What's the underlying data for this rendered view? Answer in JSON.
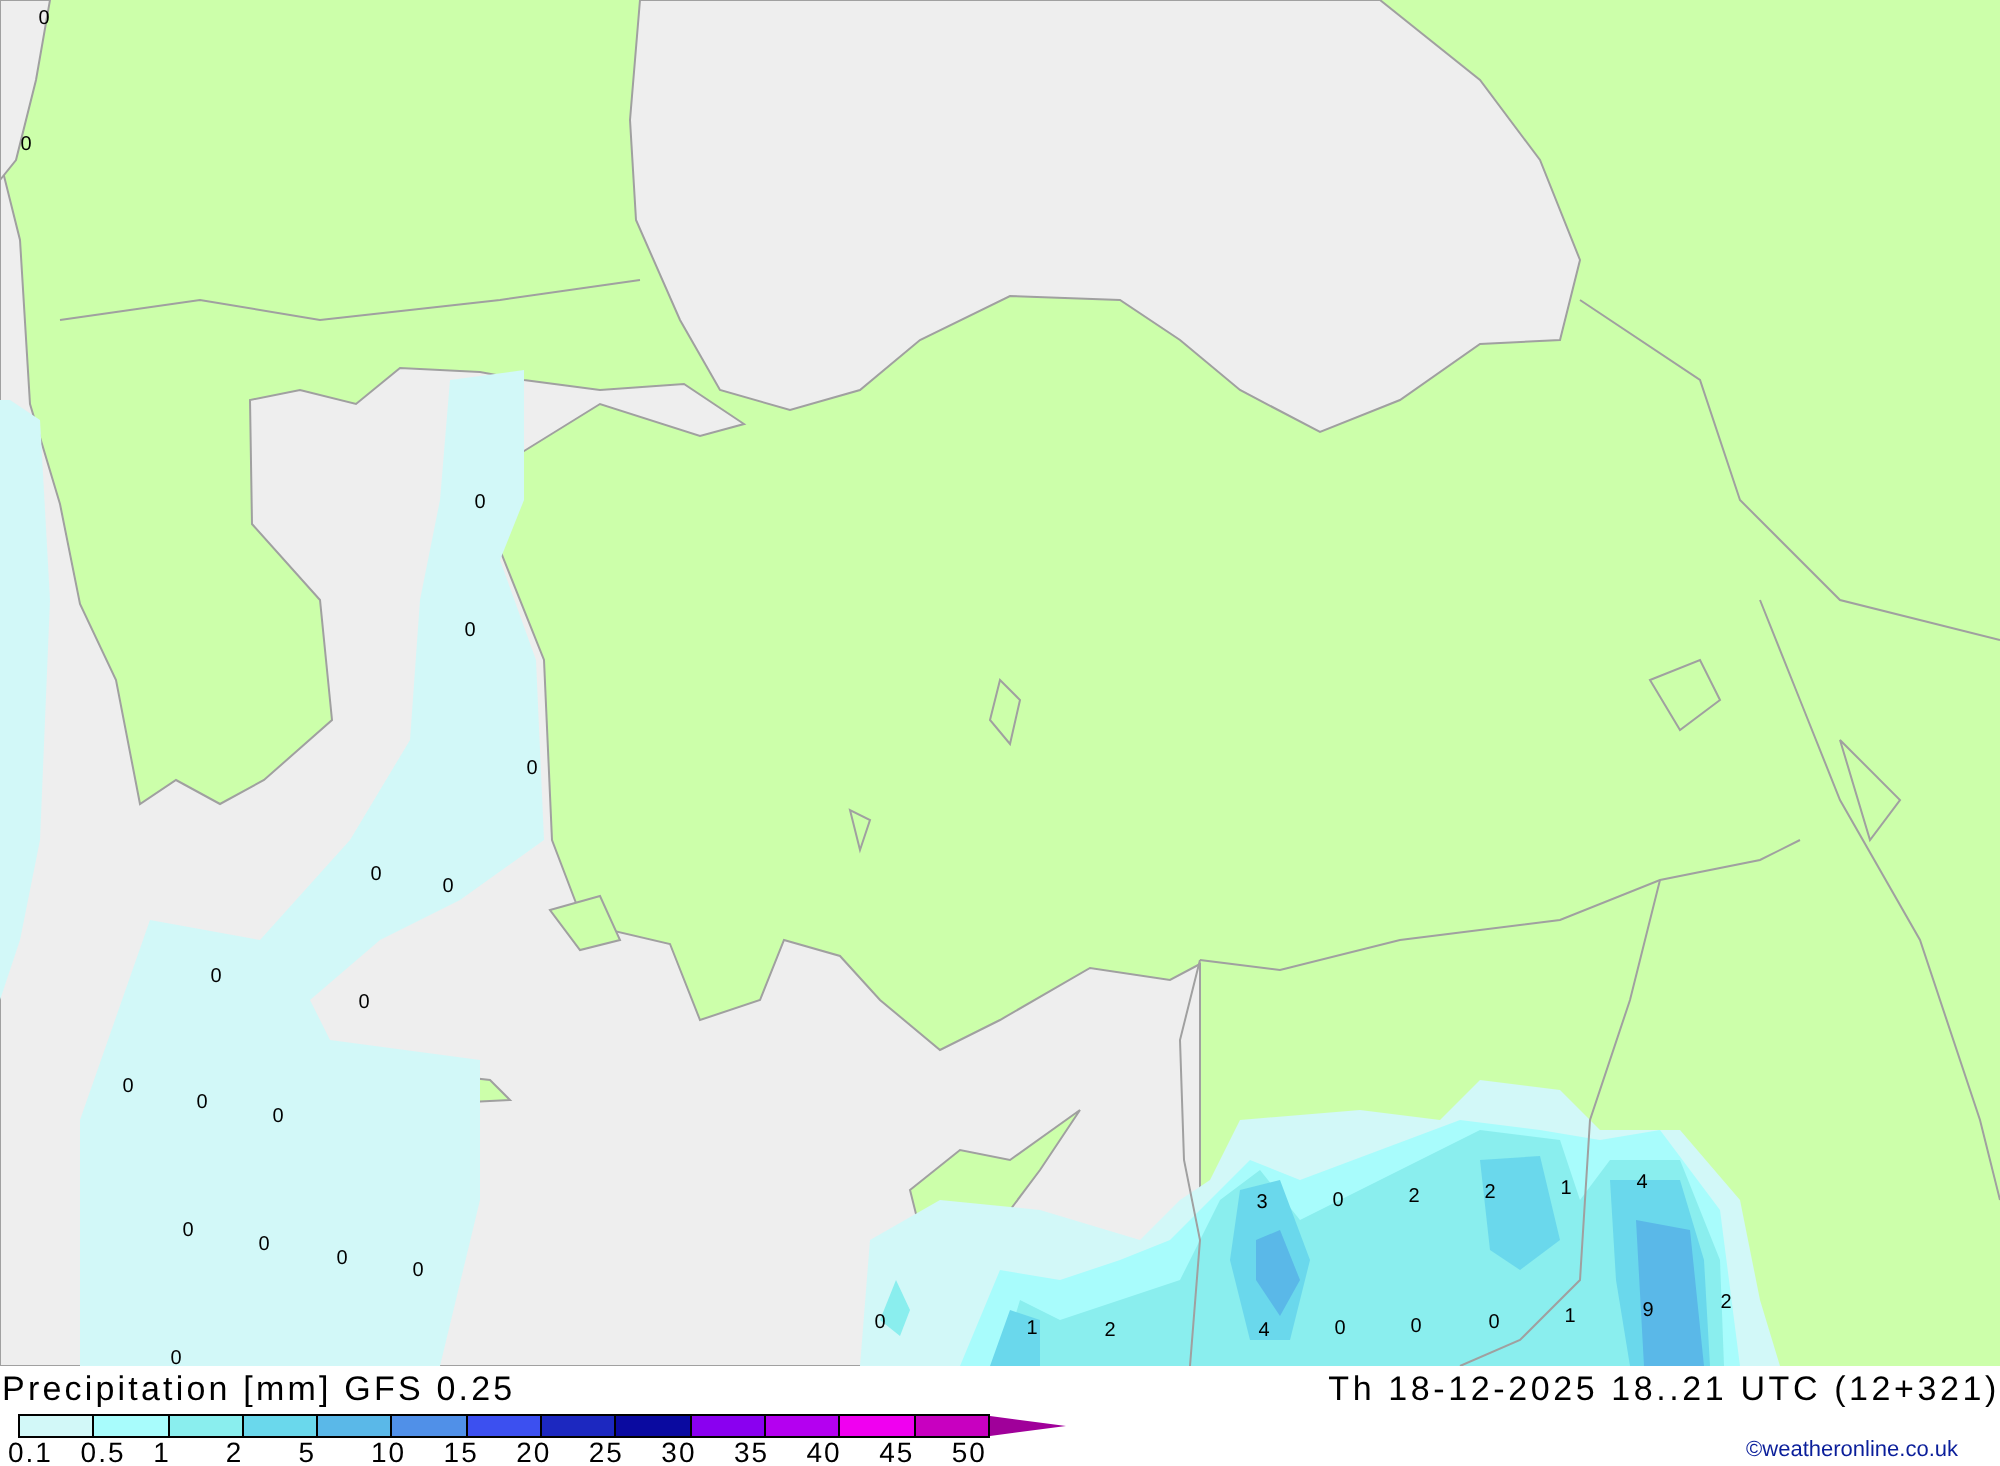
{
  "map_values": [
    "0",
    "0",
    "0",
    "0",
    "0",
    "0",
    "0",
    "0",
    "0",
    "0",
    "0",
    "0",
    "3",
    "0",
    "2",
    "2",
    "1",
    "4",
    "0",
    "0",
    "0",
    "0",
    "0",
    "1",
    "2",
    "4",
    "0",
    "0",
    "0",
    "1",
    "9",
    "2",
    "0"
  ],
  "title": "Precipitation [mm] GFS 0.25",
  "valid_time": "Th 18-12-2025 18..21 UTC (12+321)",
  "legend": {
    "items": [
      {
        "kind": "box",
        "color": "#d2f8f8"
      },
      {
        "kind": "box",
        "color": "#a8fcfc"
      },
      {
        "kind": "box",
        "color": "#8aeeee"
      },
      {
        "kind": "box",
        "color": "#6ad8ec"
      },
      {
        "kind": "box",
        "color": "#5ab8e8"
      },
      {
        "kind": "box",
        "color": "#5090e8"
      },
      {
        "kind": "box",
        "color": "#3c50f0"
      },
      {
        "kind": "box",
        "color": "#1c28c0"
      },
      {
        "kind": "box",
        "color": "#0a0aa0"
      },
      {
        "kind": "box",
        "color": "#8a00f0"
      },
      {
        "kind": "box",
        "color": "#b400f0"
      },
      {
        "kind": "box",
        "color": "#f000f0"
      },
      {
        "kind": "box",
        "color": "#c800c0"
      },
      {
        "kind": "arrow",
        "color": "#a0009a"
      }
    ],
    "ticks": [
      "0.1",
      "0.5",
      "1",
      "2",
      "5",
      "10",
      "15",
      "20",
      "25",
      "30",
      "35",
      "40",
      "45",
      "50"
    ]
  },
  "credit": "©weatheronline.co.uk"
}
